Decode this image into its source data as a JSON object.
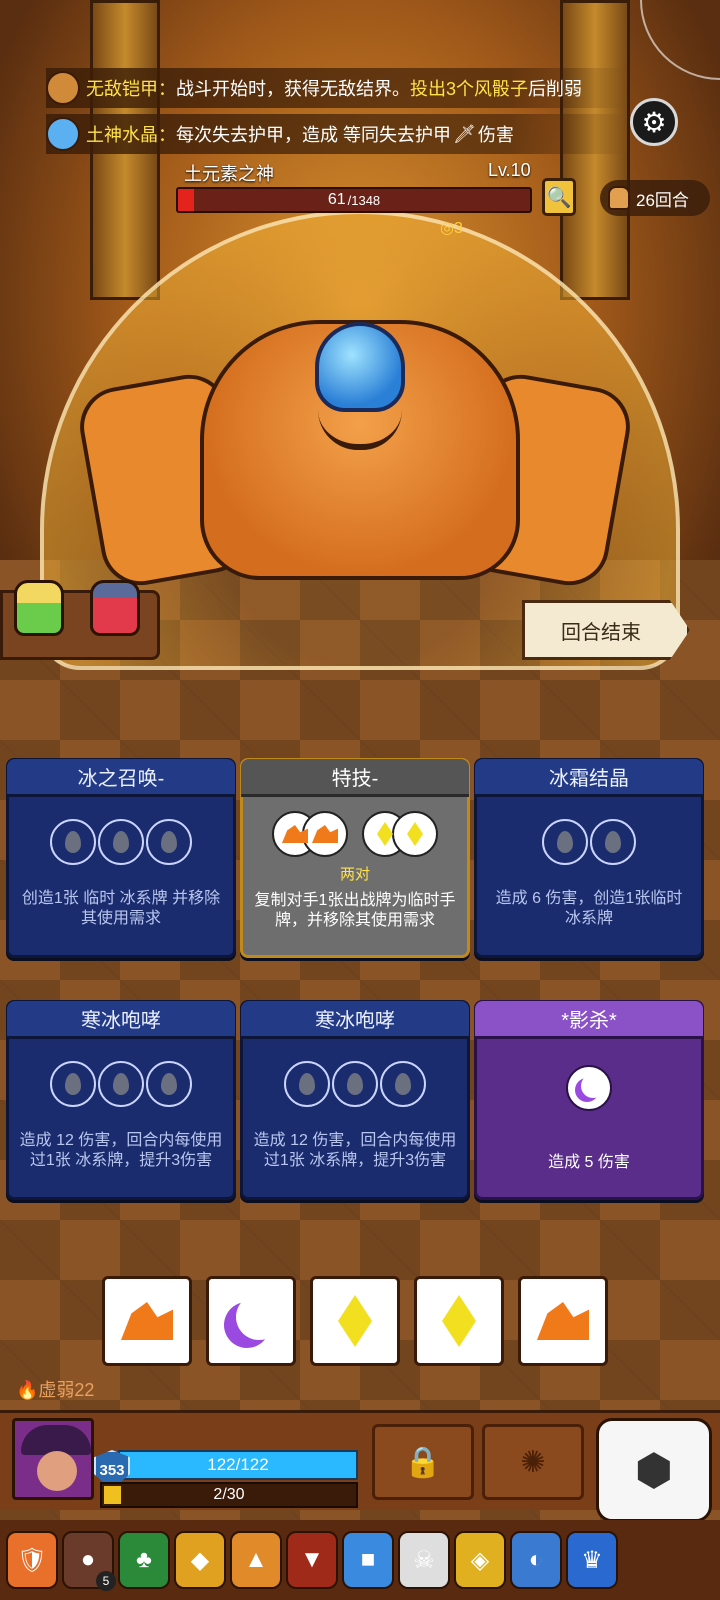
{
  "buffs": [
    {
      "label": "无敌铠甲：",
      "text_before": "战斗开始时，获得无敌结界。",
      "highlight": "投出3个风骰子",
      "text_after": "后削弱",
      "icon": "armor-icon"
    },
    {
      "label": "土神水晶：",
      "text_before": "每次失去护甲，造成 等同失去护甲",
      "highlight": "",
      "text_after": "伤害",
      "icon": "crystal-icon"
    }
  ],
  "boss": {
    "name": "土元素之神",
    "level": "Lv.10",
    "hp": "61",
    "hp_max": "/1348",
    "hp_ratio": 0.045,
    "coin_indicator": "3"
  },
  "turns": "26回合",
  "end_turn_label": "回合结束",
  "cards": [
    {
      "title": "冰之召唤-",
      "slots": 3,
      "desc": "创造1张 临时 冰系牌 并移除其使用需求",
      "style": "blue"
    },
    {
      "title": "特技-",
      "slots": 2,
      "sublabel": "两对",
      "desc": "复制对手1张出战牌为临时手牌，并移除其使用需求",
      "style": "special"
    },
    {
      "title": "冰霜结晶",
      "slots": 2,
      "desc": "造成 6 伤害，创造1张临时 冰系牌",
      "style": "blue"
    },
    {
      "title": "寒冰咆哮",
      "slots": 3,
      "desc": "造成 12 伤害，回合内每使用过1张 冰系牌，提升3伤害",
      "style": "blue"
    },
    {
      "title": "寒冰咆哮",
      "slots": 3,
      "desc": "造成 12 伤害，回合内每使用过1张 冰系牌，提升3伤害",
      "style": "blue"
    },
    {
      "title": "*影杀*",
      "slots": 1,
      "desc": "造成 5 伤害",
      "style": "purple"
    }
  ],
  "dice": [
    "earth",
    "moon",
    "lightning",
    "lightning",
    "earth"
  ],
  "status": {
    "weak": "虚弱22"
  },
  "player": {
    "armor": "353",
    "hp": "122/122",
    "hp_ratio": 1.0,
    "xp": "2/30",
    "xp_ratio": 0.067
  },
  "relics": [
    {
      "icon": "flame-shield-icon",
      "color": "#e8702a"
    },
    {
      "icon": "button-icon",
      "color": "#6a3a2a",
      "count": "5"
    },
    {
      "icon": "clover-icon",
      "color": "#2a8a3a"
    },
    {
      "icon": "frame-icon",
      "color": "#e0a020"
    },
    {
      "icon": "cake-icon",
      "color": "#e08a2a"
    },
    {
      "icon": "hood-icon",
      "color": "#a02a1a"
    },
    {
      "icon": "ice-block-icon",
      "color": "#3a8ae0"
    },
    {
      "icon": "skull-icon",
      "color": "#dedede"
    },
    {
      "icon": "amulet-icon",
      "color": "#e0b020"
    },
    {
      "icon": "shell-icon",
      "color": "#3a7ad0"
    },
    {
      "icon": "crown-icon",
      "color": "#2a6ad0"
    }
  ]
}
